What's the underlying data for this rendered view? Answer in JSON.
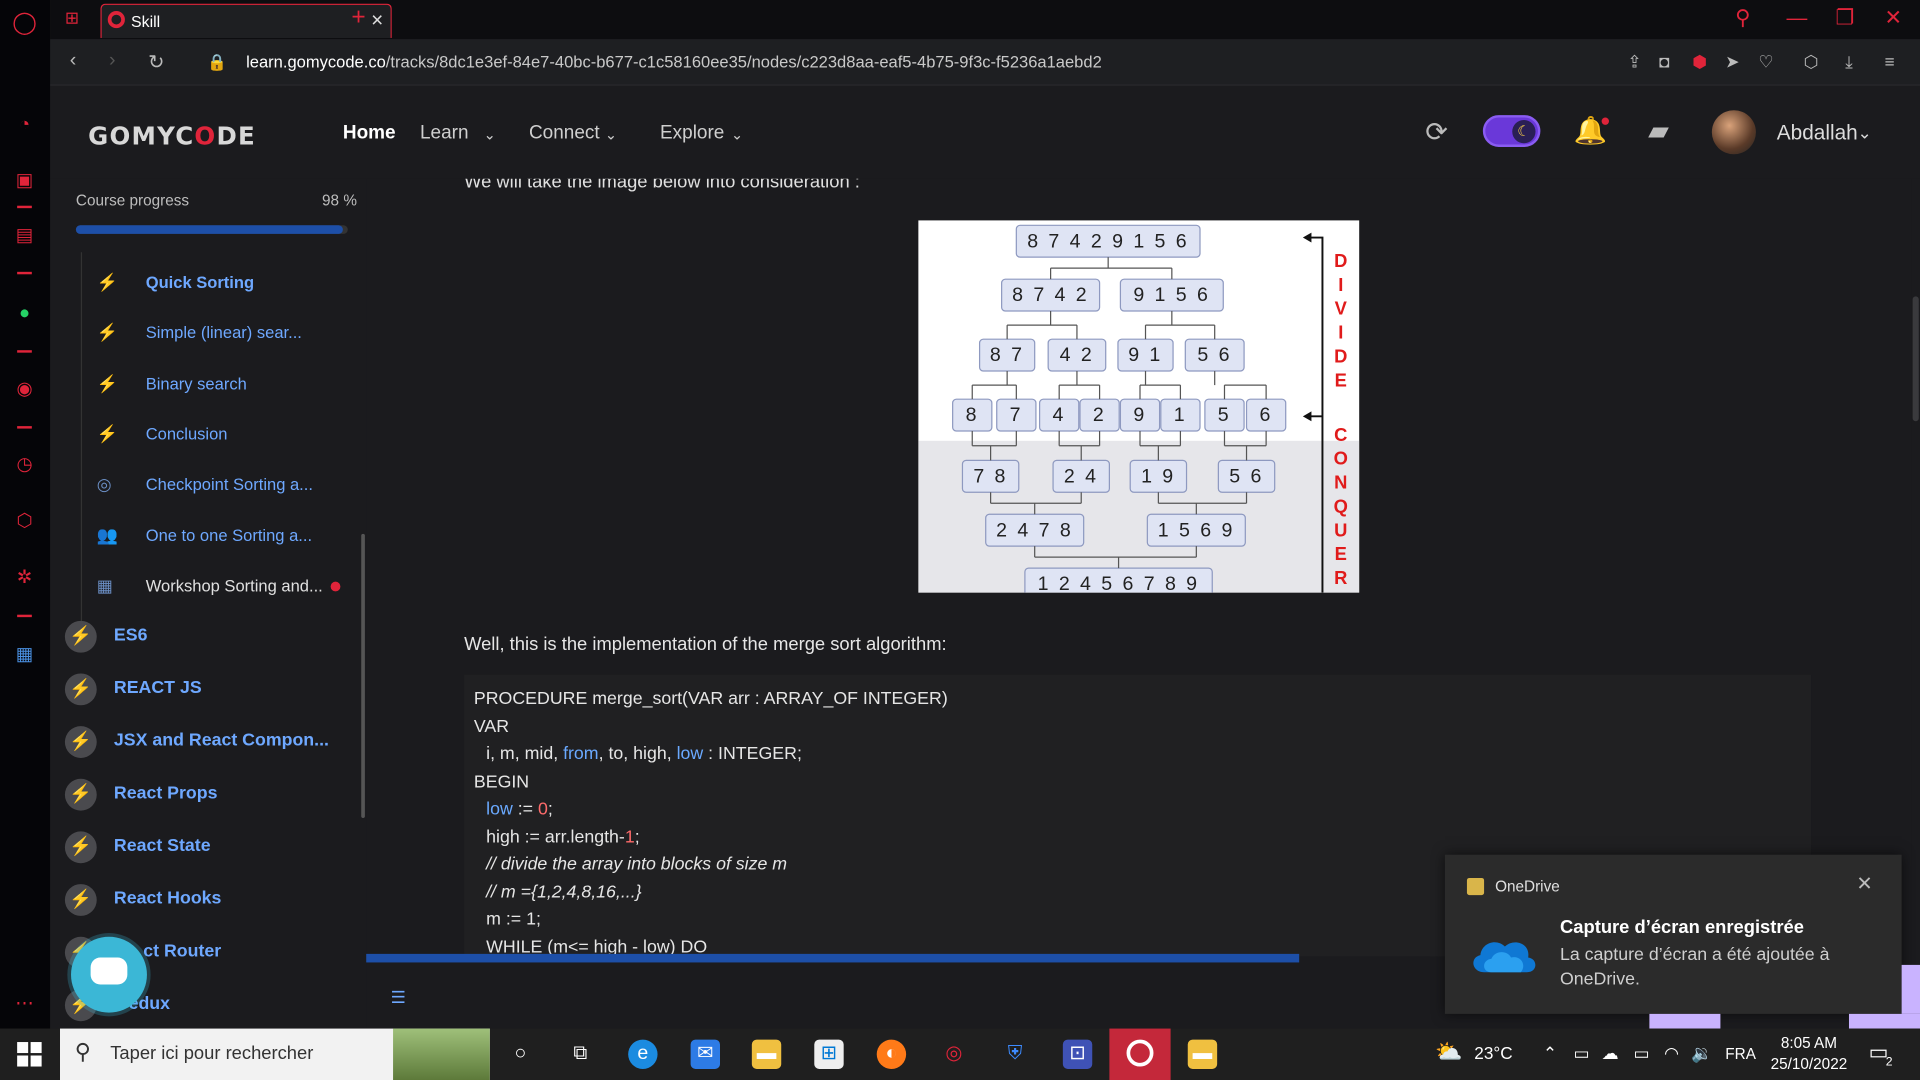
{
  "browser": {
    "tab_title": "Skill",
    "url_domain": "learn.gomycode.co",
    "url_path": "/tracks/8dc1e3ef-84e7-40bc-b677-c1c58160ee35/nodes/c223d8aa-eaf5-4b75-9f3c-f5236a1aebd2"
  },
  "header": {
    "logo_pre": "GOMYC",
    "logo_o": "O",
    "logo_post": "DE",
    "nav": [
      "Home",
      "Learn",
      "Connect",
      "Explore"
    ],
    "user_name": "Abdallah"
  },
  "sidebar": {
    "progress_label": "Course progress",
    "progress_value": "98 %",
    "progress_fraction": 0.98,
    "lessons": [
      {
        "label": "Quick Sorting",
        "icon": "bolt-icon"
      },
      {
        "label": "Simple (linear) sear...",
        "icon": "bolt-icon"
      },
      {
        "label": "Binary search",
        "icon": "bolt-icon"
      },
      {
        "label": "Conclusion",
        "icon": "bolt-icon"
      },
      {
        "label": "Checkpoint Sorting a...",
        "icon": "target-icon"
      },
      {
        "label": "One to one Sorting a...",
        "icon": "people-icon"
      },
      {
        "label": "Workshop Sorting and...",
        "icon": "workshop-icon"
      }
    ],
    "modules": [
      "ES6",
      "REACT JS",
      "JSX and React Compon...",
      "React Props",
      "React State",
      "React Hooks",
      "React Router",
      "Redux"
    ],
    "modules_visible": [
      "ES6",
      "REACT JS",
      "JSX and React Compon...",
      "React Props",
      "React State",
      "React Hooks",
      "ct Router",
      "edux"
    ]
  },
  "content": {
    "intro": "We will take the image below into consideration :",
    "impl_text": "Well, this is the implementation of the merge sort algorithm:",
    "diagram": {
      "rows": [
        [
          "8 7 4 2 9 1 5 6"
        ],
        [
          "8 7 4 2",
          "9 1 5 6"
        ],
        [
          "8 7",
          "4 2",
          "9 1",
          "5 6"
        ],
        [
          "8",
          "7",
          "4",
          "2",
          "9",
          "1",
          "5",
          "6"
        ],
        [
          "7 8",
          "2 4",
          "1 9",
          "5 6"
        ],
        [
          "2 4 7 8",
          "1 5 6 9"
        ],
        [
          "1 2 4 5 6 7 8 9"
        ]
      ],
      "divide": "DIVIDE",
      "conquer": "CONQUER"
    },
    "code": [
      "PROCEDURE merge_sort(VAR arr : ARRAY_OF INTEGER)",
      "VAR",
      "i, m, mid, from, to, high, low : INTEGER;",
      "BEGIN",
      "low := 0;",
      "high := arr.length-1;",
      "// divide the array into blocks of size m",
      "// m ={1,2,4,8,16,...}",
      "m := 1;",
      "WHILE (m<= high - low) DO"
    ]
  },
  "notification": {
    "app": "OneDrive",
    "title": "Capture d’écran enregistrée",
    "body": "La capture d’écran a été ajoutée à OneDrive."
  },
  "taskbar": {
    "search_placeholder": "Taper ici pour rechercher",
    "weather": "23°C",
    "lang": "FRA",
    "time": "8:05 AM",
    "date": "25/10/2022",
    "notif_count": "2"
  },
  "colors": {
    "accent_red": "#e0243a",
    "link_blue": "#6ea8ff",
    "progress_blue": "#1d4fa8",
    "background": "#1b1b1e"
  }
}
